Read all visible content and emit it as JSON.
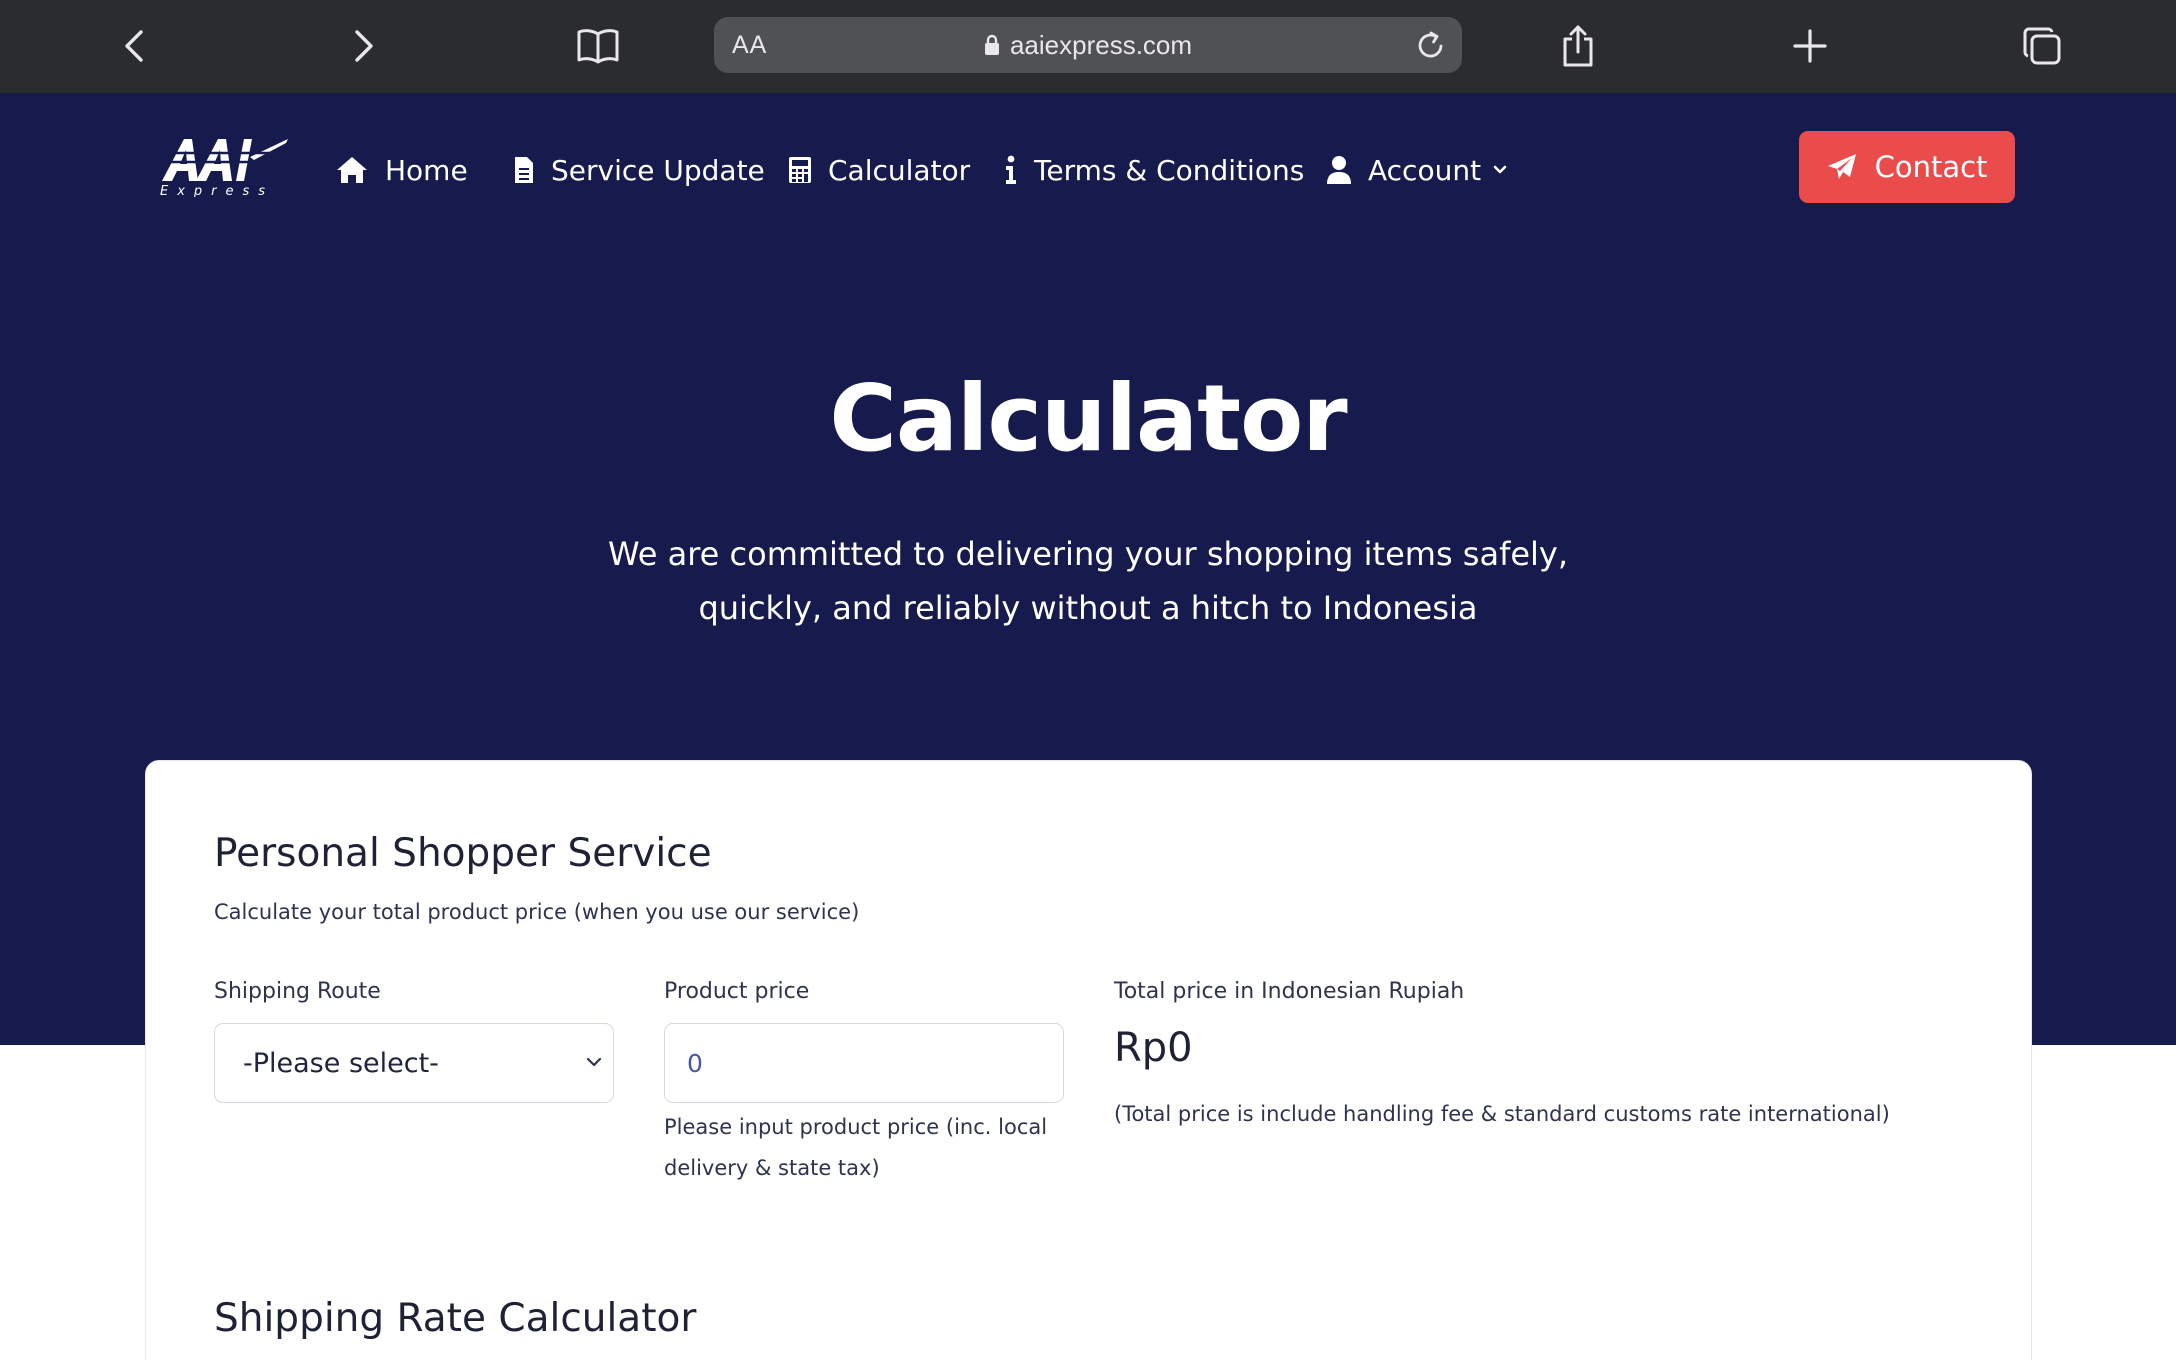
{
  "browser": {
    "text_size_label": "AA",
    "url": "aaiexpress.com",
    "icons": [
      "back-icon",
      "forward-icon",
      "bookmarks-icon",
      "lock-icon",
      "reload-icon",
      "share-icon",
      "new-tab-icon",
      "tabs-icon"
    ]
  },
  "site": {
    "logo_text": "AAI",
    "logo_subtext": "Express",
    "nav": {
      "home": "Home",
      "service_update": "Service Update",
      "calculator": "Calculator",
      "terms": "Terms & Conditions",
      "account": "Account",
      "contact": "Contact"
    },
    "hero": {
      "title": "Calculator",
      "subtitle_line1": "We are committed to delivering your shopping items safely,",
      "subtitle_line2": "quickly, and reliably without a hitch to Indonesia"
    },
    "colors": {
      "navy": "#161a4c",
      "contact_red": "#ea4c4c",
      "browser_bar": "#2b2c2e"
    }
  },
  "personal_shopper": {
    "title": "Personal Shopper Service",
    "description": "Calculate your total product price (when you use our service)",
    "shipping_route_label": "Shipping Route",
    "shipping_route_value": "-Please select-",
    "product_price_label": "Product price",
    "product_price_value": "0",
    "product_price_help": "Please input product price (inc. local delivery & state tax)",
    "total_label": "Total price in Indonesian Rupiah",
    "total_value": "Rp0",
    "total_note": "(Total price is include handling fee & standard customs rate international)"
  },
  "shipping_rate": {
    "title": "Shipping Rate Calculator"
  }
}
